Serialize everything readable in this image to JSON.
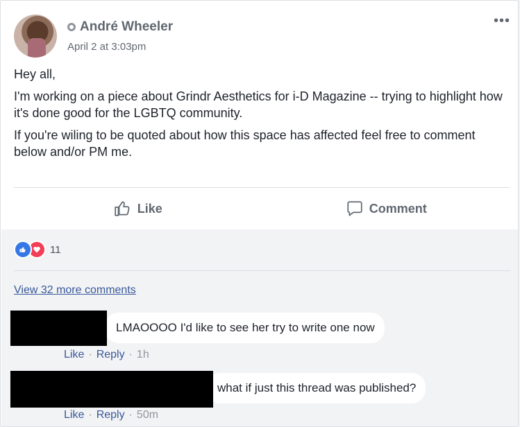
{
  "post": {
    "author": "André Wheeler",
    "time": "April 2 at 3:03pm",
    "more": "•••",
    "paragraphs": [
      "Hey all,",
      "I'm working on a piece about Grindr Aesthetics for i-D Magazine -- trying to highlight how it's done good for the LGBTQ community.",
      "If you're wiling to be quoted about how this space has affected feel free to comment below and/or PM me."
    ]
  },
  "actions": {
    "like": "Like",
    "comment": "Comment"
  },
  "reactions": {
    "count": "11",
    "colors": {
      "like": "#3578e5",
      "love": "#f33e58"
    }
  },
  "comments_link": "View 32 more comments",
  "comments": [
    {
      "text": "LMAOOOO I'd like to see her try to write one now",
      "like": "Like",
      "reply": "Reply",
      "age": "1h"
    },
    {
      "text": "what if just this thread was published?",
      "like": "Like",
      "reply": "Reply",
      "age": "50m"
    }
  ],
  "icons": {
    "audience": "globe-icon",
    "like": "thumbs-up-icon",
    "comment": "speech-bubble-icon"
  }
}
